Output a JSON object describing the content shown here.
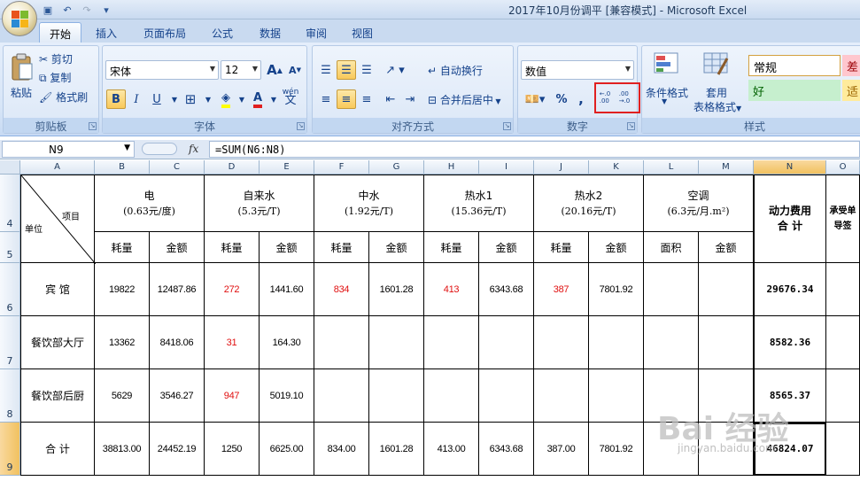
{
  "window": {
    "title": "2017年10月份调平  [兼容模式] - Microsoft Excel"
  },
  "tabs": [
    "开始",
    "插入",
    "页面布局",
    "公式",
    "数据",
    "审阅",
    "视图"
  ],
  "active_tab": "开始",
  "clipboard": {
    "paste": "粘贴",
    "cut": "剪切",
    "copy": "复制",
    "format_painter": "格式刷",
    "label": "剪贴板"
  },
  "font": {
    "name": "宋体",
    "size": "12",
    "grow": "A",
    "shrink": "A",
    "bold": "B",
    "italic": "I",
    "underline": "U",
    "phonetic": "wén",
    "phonetic_char": "文",
    "label": "字体"
  },
  "alignment": {
    "wrap_text": "自动换行",
    "merge_center": "合并后居中",
    "label": "对齐方式"
  },
  "number": {
    "format": "数值",
    "percent": "%",
    "comma": ",",
    "increase_decimal": ".0 .00 ←",
    "decrease_decimal": ".00 .0 →",
    "label": "数字"
  },
  "styles": {
    "conditional": "条件格式",
    "table_format_1": "套用",
    "table_format_2": "表格格式",
    "normal": "常规",
    "bad": "差",
    "good": "好",
    "neutral": "适",
    "label": "样式"
  },
  "formula_bar": {
    "cell_ref": "N9",
    "fx": "fx",
    "formula": "=SUM(N6:N8)"
  },
  "columns": [
    "A",
    "B",
    "C",
    "D",
    "E",
    "F",
    "G",
    "H",
    "I",
    "J",
    "K",
    "L",
    "M",
    "N",
    "O"
  ],
  "rows": [
    "4",
    "5",
    "6",
    "7",
    "8",
    "9"
  ],
  "sheet": {
    "header": {
      "diag_item": "项目",
      "diag_unit": "单位",
      "groups": [
        {
          "name": "电",
          "unit": "(0.63元/度)"
        },
        {
          "name": "自来水",
          "unit": "(5.3元/T)"
        },
        {
          "name": "中水",
          "unit": "(1.92元/T)"
        },
        {
          "name": "热水1",
          "unit": "(15.36元/T)"
        },
        {
          "name": "热水2",
          "unit": "(20.16元/T)"
        },
        {
          "name": "空调",
          "unit": "(6.3元/月.m²)"
        }
      ],
      "total_1": "动力费用",
      "total_2": "合 计",
      "sub_o_1": "承受单",
      "sub_o_2": "导签",
      "sub": [
        "耗量",
        "金额",
        "耗量",
        "金额",
        "耗量",
        "金额",
        "耗量",
        "金额",
        "耗量",
        "金额",
        "面积",
        "金额"
      ]
    },
    "data": [
      {
        "unit": "宾 馆",
        "values": [
          "19822",
          "12487.86",
          "272",
          "1441.60",
          "834",
          "1601.28",
          "413",
          "6343.68",
          "387",
          "7801.92",
          "",
          ""
        ],
        "total": "29676.34"
      },
      {
        "unit": "餐饮部大厅",
        "values": [
          "13362",
          "8418.06",
          "31",
          "164.30",
          "",
          "",
          "",
          "",
          "",
          "",
          "",
          ""
        ],
        "total": "8582.36"
      },
      {
        "unit": "餐饮部后厨",
        "values": [
          "5629",
          "3546.27",
          "947",
          "5019.10",
          "",
          "",
          "",
          "",
          "",
          "",
          "",
          ""
        ],
        "total": "8565.37"
      },
      {
        "unit": "合  计",
        "values": [
          "38813.00",
          "24452.19",
          "1250",
          "6625.00",
          "834.00",
          "1601.28",
          "413.00",
          "6343.68",
          "387.00",
          "7801.92",
          "",
          ""
        ],
        "total": "46824.07"
      }
    ]
  },
  "watermark": {
    "main": "Bai 经验",
    "sub": "jingyan.baidu.com"
  }
}
